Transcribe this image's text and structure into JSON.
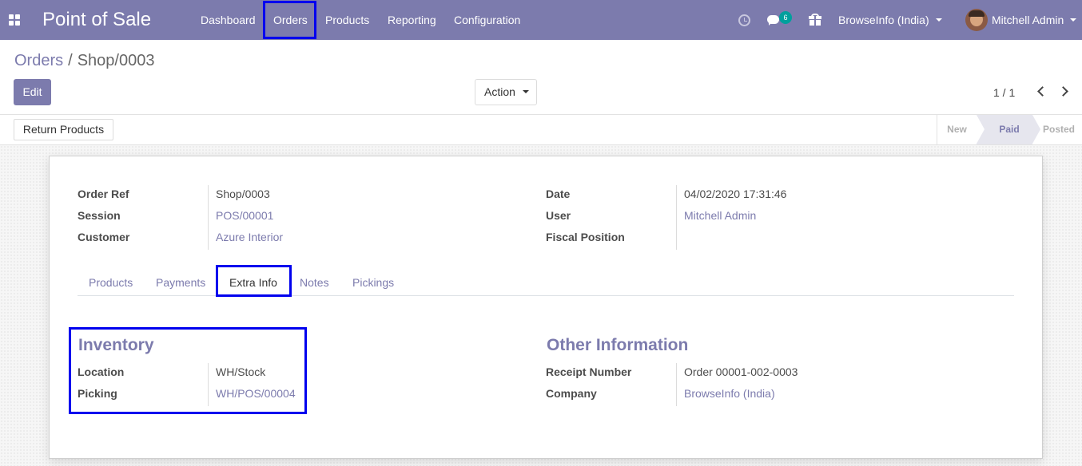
{
  "navbar": {
    "app_title": "Point of Sale",
    "menu": [
      "Dashboard",
      "Orders",
      "Products",
      "Reporting",
      "Configuration"
    ],
    "active_menu": "Orders",
    "message_count": "6",
    "company": "BrowseInfo (India)",
    "user": "Mitchell Admin",
    "bg_color": "#7c7bad",
    "icons": [
      "apps-icon",
      "clock-icon",
      "chat-icon",
      "gift-icon"
    ]
  },
  "breadcrumb": {
    "parent": "Orders",
    "separator": "/",
    "current": "Shop/0003"
  },
  "control_panel": {
    "edit_label": "Edit",
    "action_label": "Action",
    "pager": "1 / 1"
  },
  "statusbar": {
    "return_label": "Return Products",
    "stages": [
      "New",
      "Paid",
      "Posted"
    ],
    "current_stage": "Paid"
  },
  "order": {
    "left_fields": [
      {
        "label": "Order Ref",
        "value": "Shop/0003"
      },
      {
        "label": "Session",
        "value": "POS/00001"
      },
      {
        "label": "Customer",
        "value": "Azure Interior"
      }
    ],
    "right_fields": [
      {
        "label": "Date",
        "value": "04/02/2020 17:31:46"
      },
      {
        "label": "User",
        "value": "Mitchell Admin"
      },
      {
        "label": "Fiscal Position",
        "value": ""
      }
    ]
  },
  "tabs": [
    "Products",
    "Payments",
    "Extra Info",
    "Notes",
    "Pickings"
  ],
  "active_tab": "Extra Info",
  "inventory": {
    "title": "Inventory",
    "fields": [
      {
        "label": "Location",
        "value": "WH/Stock"
      },
      {
        "label": "Picking",
        "value": "WH/POS/00004"
      }
    ]
  },
  "other_info": {
    "title": "Other Information",
    "fields": [
      {
        "label": "Receipt Number",
        "value": "Order 00001-002-0003"
      },
      {
        "label": "Company",
        "value": "BrowseInfo (India)"
      }
    ]
  },
  "colors": {
    "accent": "#7c7bad",
    "highlight": "#0000ee",
    "badge": "#00a09d"
  }
}
